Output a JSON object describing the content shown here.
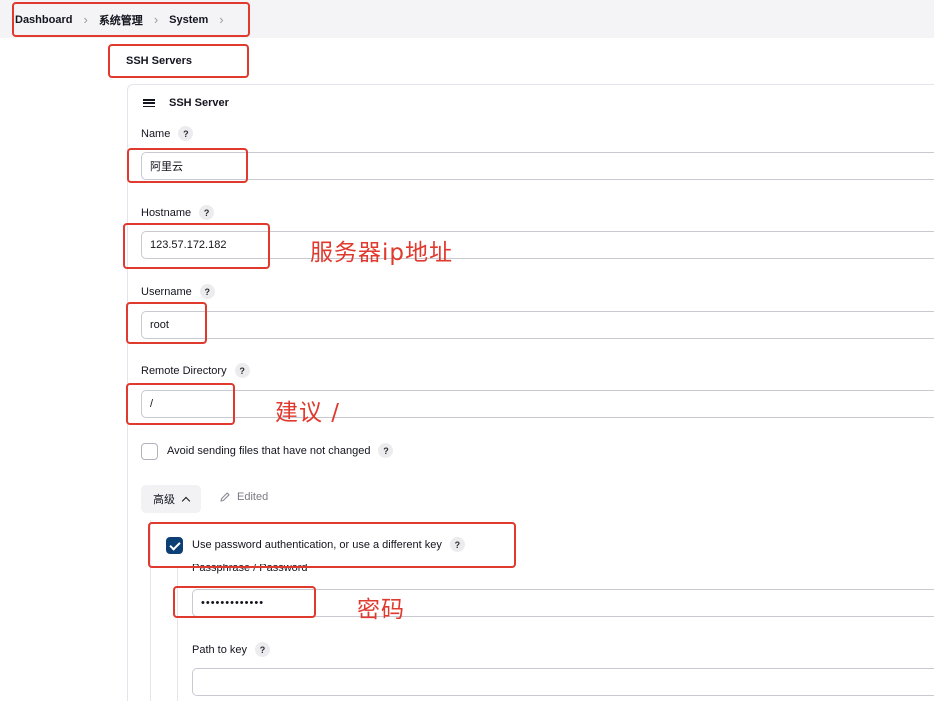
{
  "breadcrumb": {
    "items": [
      {
        "label": "Dashboard"
      },
      {
        "label": "系统管理"
      },
      {
        "label": "System"
      }
    ]
  },
  "section": {
    "title": "SSH Servers"
  },
  "card": {
    "title": "SSH Server",
    "fields": {
      "name": {
        "label": "Name",
        "value": "阿里云"
      },
      "hostname": {
        "label": "Hostname",
        "value": "123.57.172.182"
      },
      "username": {
        "label": "Username",
        "value": "root"
      },
      "remote_dir": {
        "label": "Remote Directory",
        "value": "/"
      }
    },
    "avoid_sending": {
      "label": "Avoid sending files that have not changed",
      "checked": false
    },
    "advanced": {
      "button_label": "高级",
      "edited_label": "Edited"
    },
    "use_password": {
      "label": "Use password authentication, or use a different key",
      "checked": true
    },
    "passphrase": {
      "label": "Passphrase / Password",
      "value": "•••••••••••••"
    },
    "path_to_key": {
      "label": "Path to key",
      "value": ""
    }
  },
  "help_glyph": "?",
  "annotations": {
    "hostname_note": "服务器ip地址",
    "remote_dir_note": "建议 /",
    "password_note": "密码"
  },
  "colors": {
    "annotation_red": "#e0392e",
    "checkbox_blue": "#0c3f74"
  }
}
